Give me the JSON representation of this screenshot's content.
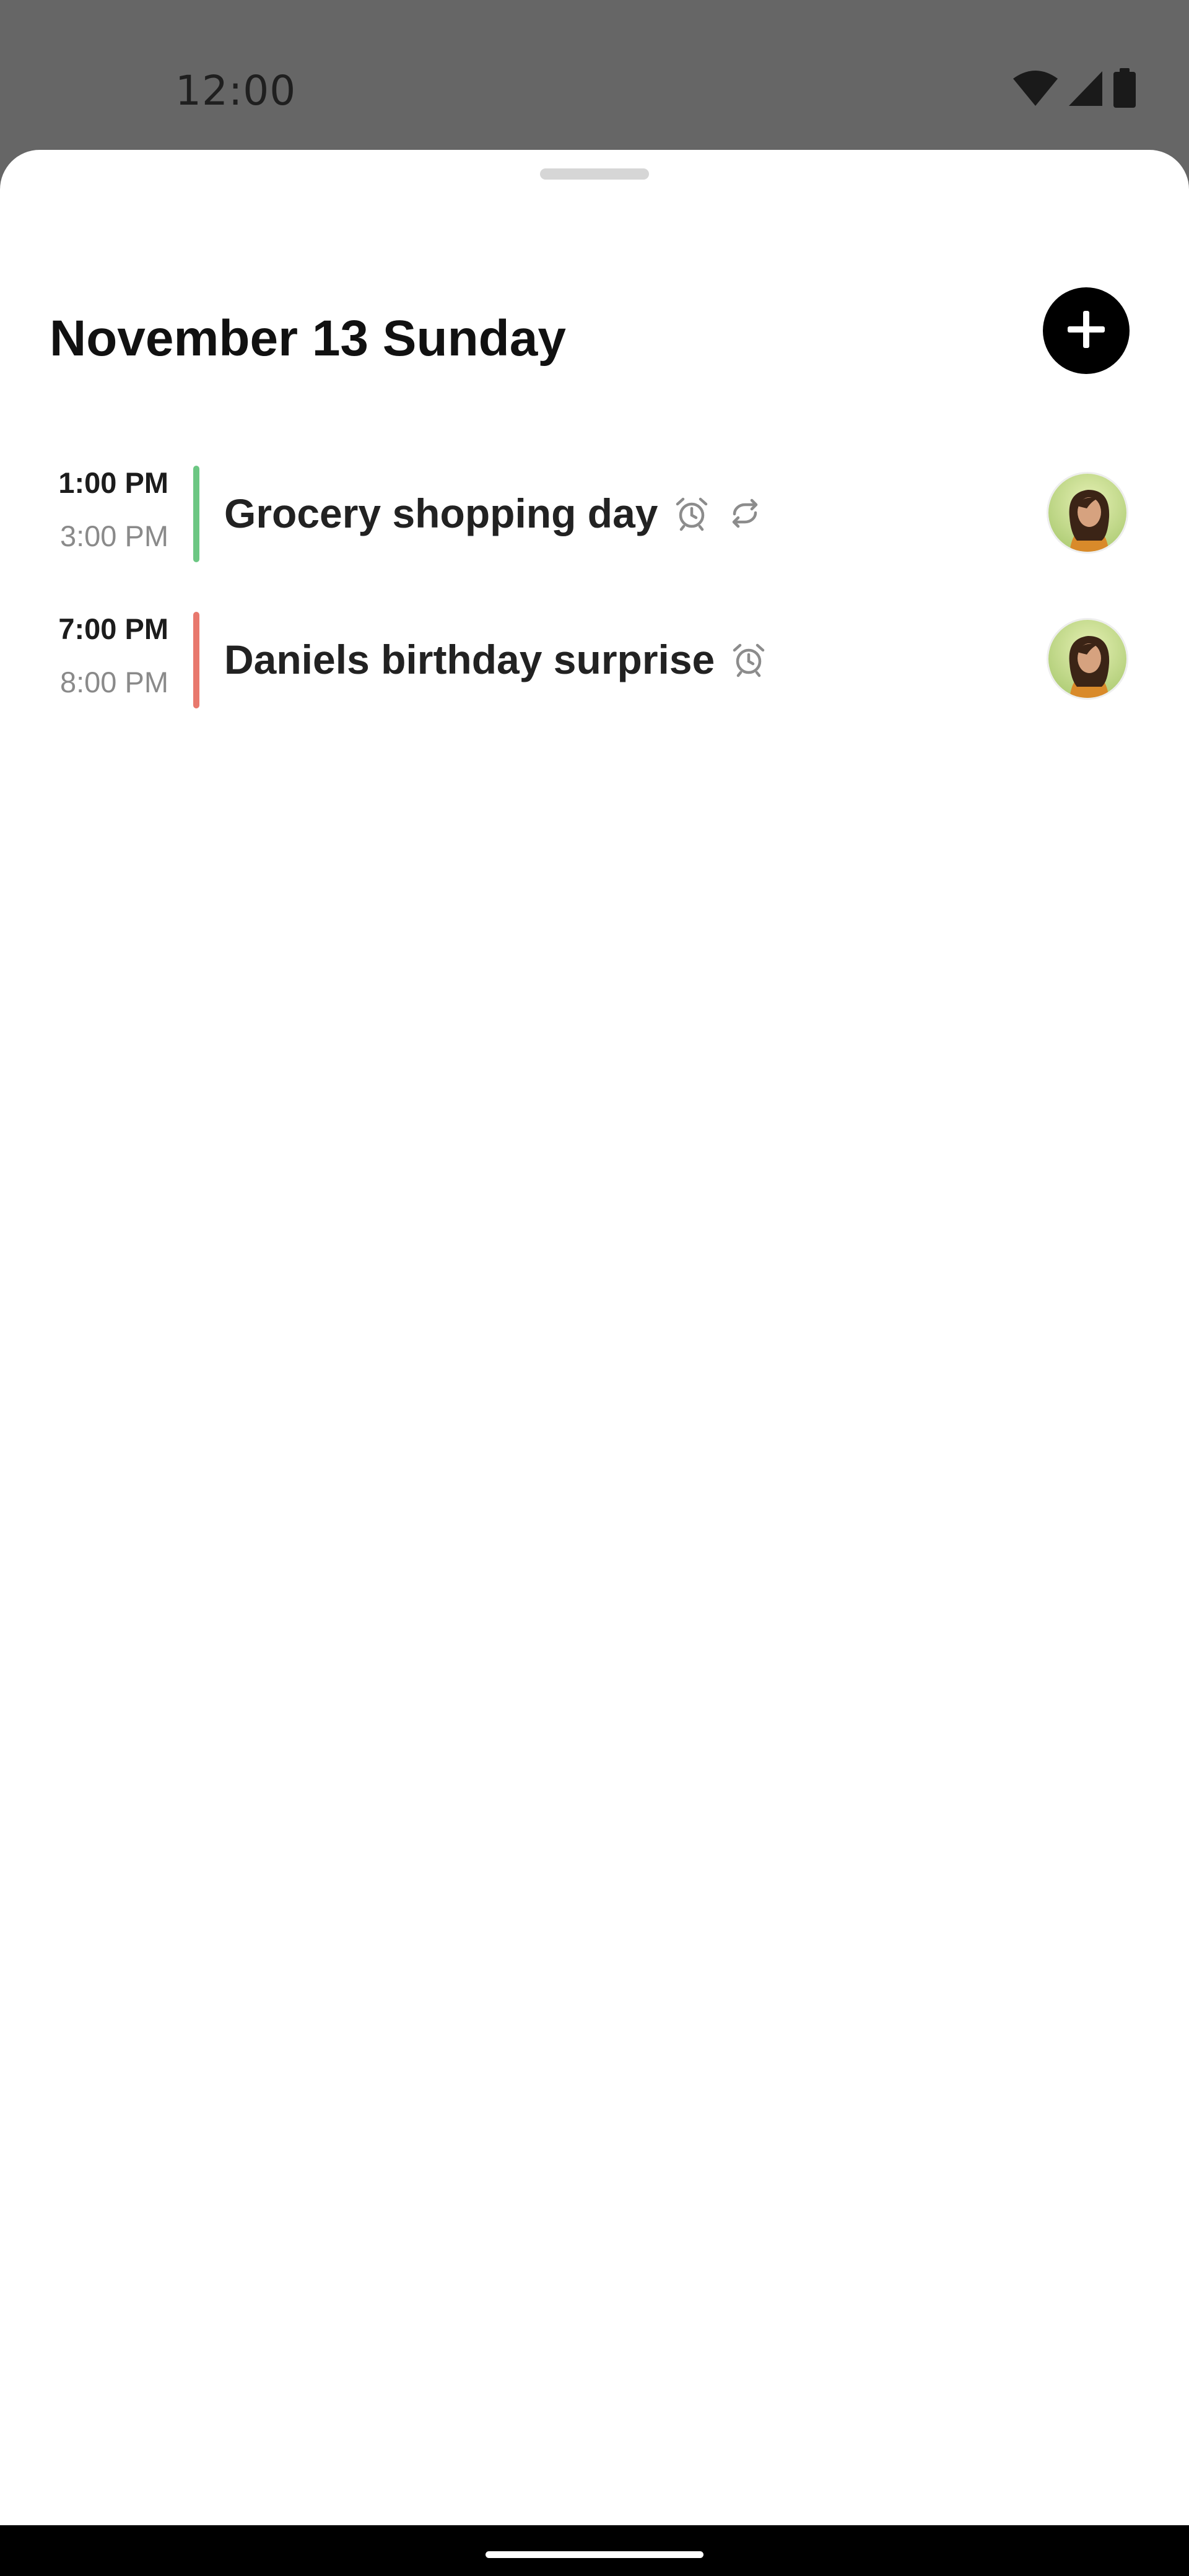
{
  "status_bar": {
    "time": "12:00",
    "icons": [
      "wifi-icon",
      "cellular-signal-icon",
      "battery-icon"
    ]
  },
  "sheet": {
    "title": "November 13 Sunday",
    "add_icon": "plus-icon"
  },
  "events": [
    {
      "start": "1:00 PM",
      "end": "3:00 PM",
      "title": "Grocery shopping day",
      "color": "#6cc783",
      "icons": [
        "alarm-icon",
        "repeat-icon"
      ]
    },
    {
      "start": "7:00 PM",
      "end": "8:00 PM",
      "title": "Daniels birthday surprise",
      "color": "#e8786d",
      "icons": [
        "alarm-icon"
      ]
    }
  ],
  "colors": {
    "scrim": "#666666",
    "sheet_background": "#ffffff",
    "accent_button": "#000000"
  }
}
